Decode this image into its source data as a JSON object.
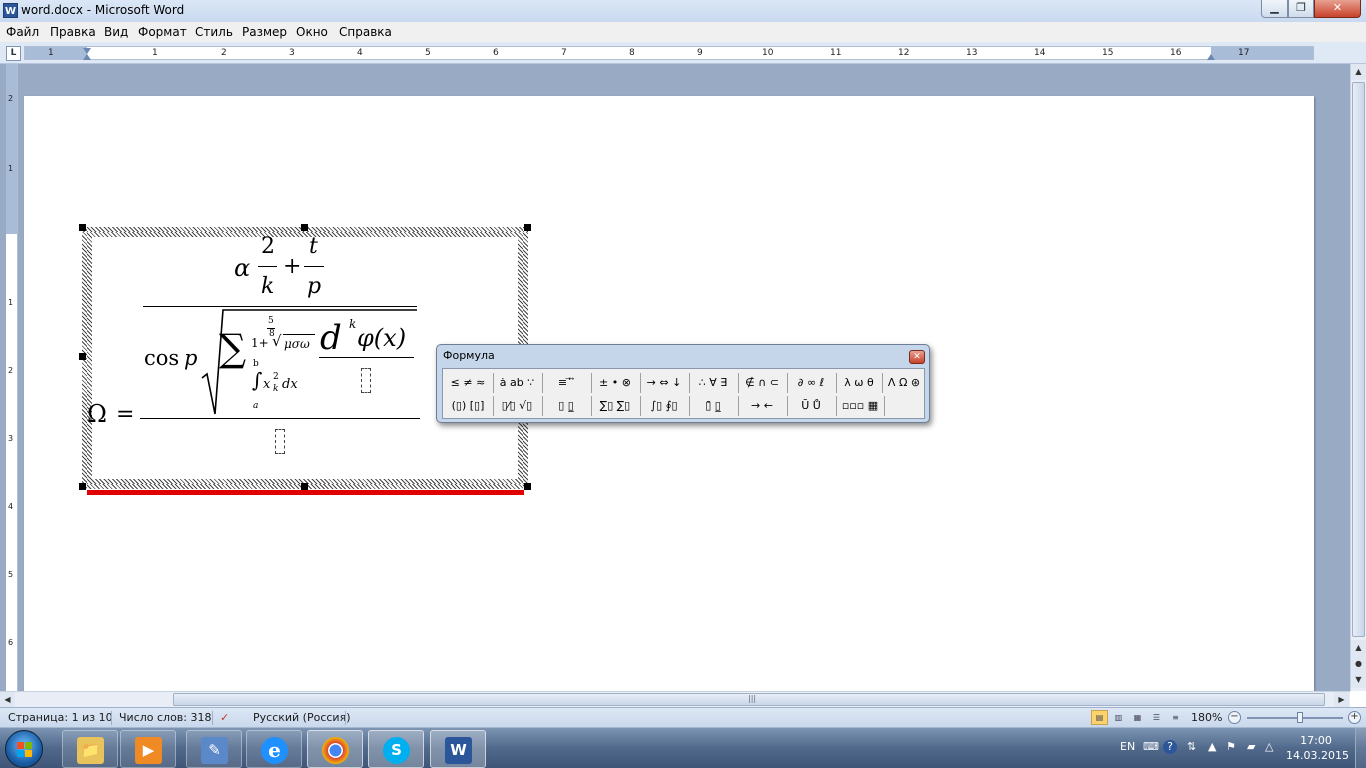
{
  "window": {
    "title": "word.docx - Microsoft Word",
    "app_icon_letter": "W",
    "min_glyph": "▁",
    "max_glyph": "❐",
    "close_glyph": "✕"
  },
  "menu": {
    "items": [
      "Файл",
      "Правка",
      "Вид",
      "Формат",
      "Стиль",
      "Размер",
      "Окно",
      "Справка"
    ]
  },
  "ruler": {
    "tab_type": "L",
    "horizontal_numbers": [
      "1",
      "1",
      "2",
      "3",
      "4",
      "5",
      "6",
      "7",
      "8",
      "9",
      "10",
      "11",
      "12",
      "13",
      "14",
      "15",
      "16",
      "17"
    ],
    "vertical_numbers": [
      "2",
      "1",
      "1",
      "2",
      "3",
      "4",
      "5",
      "6"
    ]
  },
  "equation": {
    "omega": "Ω",
    "equals": "=",
    "alpha": "α",
    "two": "2",
    "k": "k",
    "plus": "+",
    "t": "t",
    "p": "p",
    "cos": "cos",
    "cos_arg": "p",
    "sigma": "∑",
    "sum_upper": "1+",
    "root_index_num": "5",
    "root_index_den": "8",
    "root_glyph": "√",
    "radicand": "μσω",
    "integral": "∫",
    "int_upper": "b",
    "int_lower": "a",
    "integrand_x": "x",
    "integrand_sup": "2",
    "integrand_sub": "k",
    "integrand_dx": "dx",
    "d": "d",
    "d_exp": "k",
    "phi_x": "φ(x)"
  },
  "formula_toolbar": {
    "title": "Формула",
    "close_glyph": "✕",
    "row1": [
      "≤ ≠ ≈",
      "ȧ ab ∵",
      "≡ ⃗ ⃡",
      "± • ⊗",
      "→ ⇔ ↓",
      "∴ ∀ ∃",
      "∉ ∩ ⊂",
      "∂ ∞ ℓ",
      "λ ω θ",
      "Λ Ω ⊛"
    ],
    "row2": [
      "(▯) [▯]",
      "▯⁄▯ √▯",
      "▯ ▯̲",
      "∑▯ ∑▯",
      "∫▯ ∮▯",
      "▯̄ ▯̲",
      "→ ←",
      "Ū Ů",
      "▫▫▫ ▦"
    ]
  },
  "status": {
    "page": "Страница: 1 из 10",
    "words": "Число слов: 318",
    "language": "Русский (Россия)",
    "zoom": "180%",
    "zoom_level_pct": 180,
    "zoom_minus": "−",
    "zoom_plus": "+"
  },
  "taskbar": {
    "apps": [
      "Explorer",
      "Media Player",
      "Paint",
      "Internet Explorer",
      "Chrome",
      "Skype",
      "Word"
    ],
    "app_glyphs": [
      "📁",
      "▶",
      "✎",
      "e",
      "◉",
      "S",
      "W"
    ],
    "language": "EN",
    "time": "17:00",
    "date": "14.03.2015"
  },
  "colors": {
    "accent_blue": "#2b579a",
    "error_underline": "#e00000",
    "docarea_bg": "#99abc4"
  }
}
